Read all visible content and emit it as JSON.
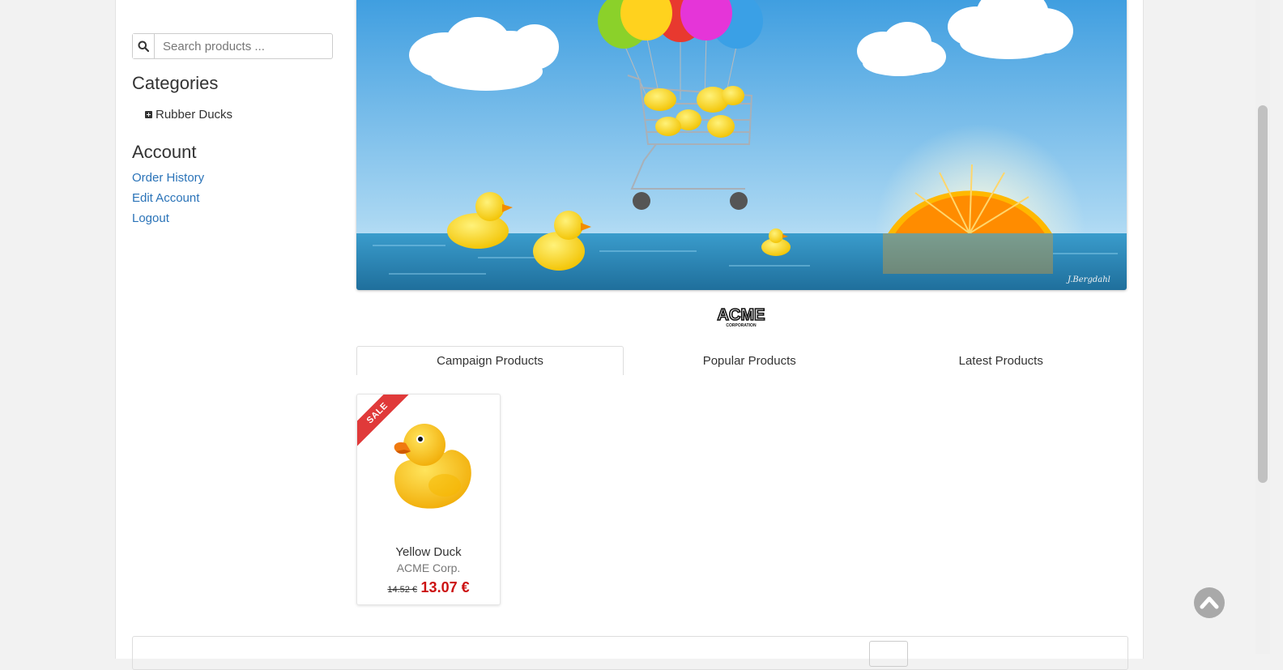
{
  "search": {
    "placeholder": "Search products ...",
    "icon": "search-icon"
  },
  "sidebar": {
    "categories_title": "Categories",
    "categories": [
      {
        "label": "Rubber Ducks",
        "icon": "plus-square-icon"
      }
    ],
    "account_title": "Account",
    "account_links": [
      {
        "label": "Order History"
      },
      {
        "label": "Edit Account"
      },
      {
        "label": "Logout"
      }
    ]
  },
  "banner": {
    "signature": "J.Bergdahl"
  },
  "brand": {
    "logo_main": "ACME",
    "logo_sub": "CORPORATION"
  },
  "tabs": [
    {
      "label": "Campaign Products",
      "active": true
    },
    {
      "label": "Popular Products",
      "active": false
    },
    {
      "label": "Latest Products",
      "active": false
    }
  ],
  "products": [
    {
      "badge": "SALE",
      "name": "Yellow Duck",
      "manufacturer": "ACME Corp.",
      "regular_price": "14.52 €",
      "campaign_price": "13.07 €"
    }
  ],
  "colors": {
    "link": "#2a73b8",
    "sale": "#e03a3a",
    "price": "#cc1111",
    "sky": "#6bb7ea",
    "sea": "#2f8fbf"
  }
}
